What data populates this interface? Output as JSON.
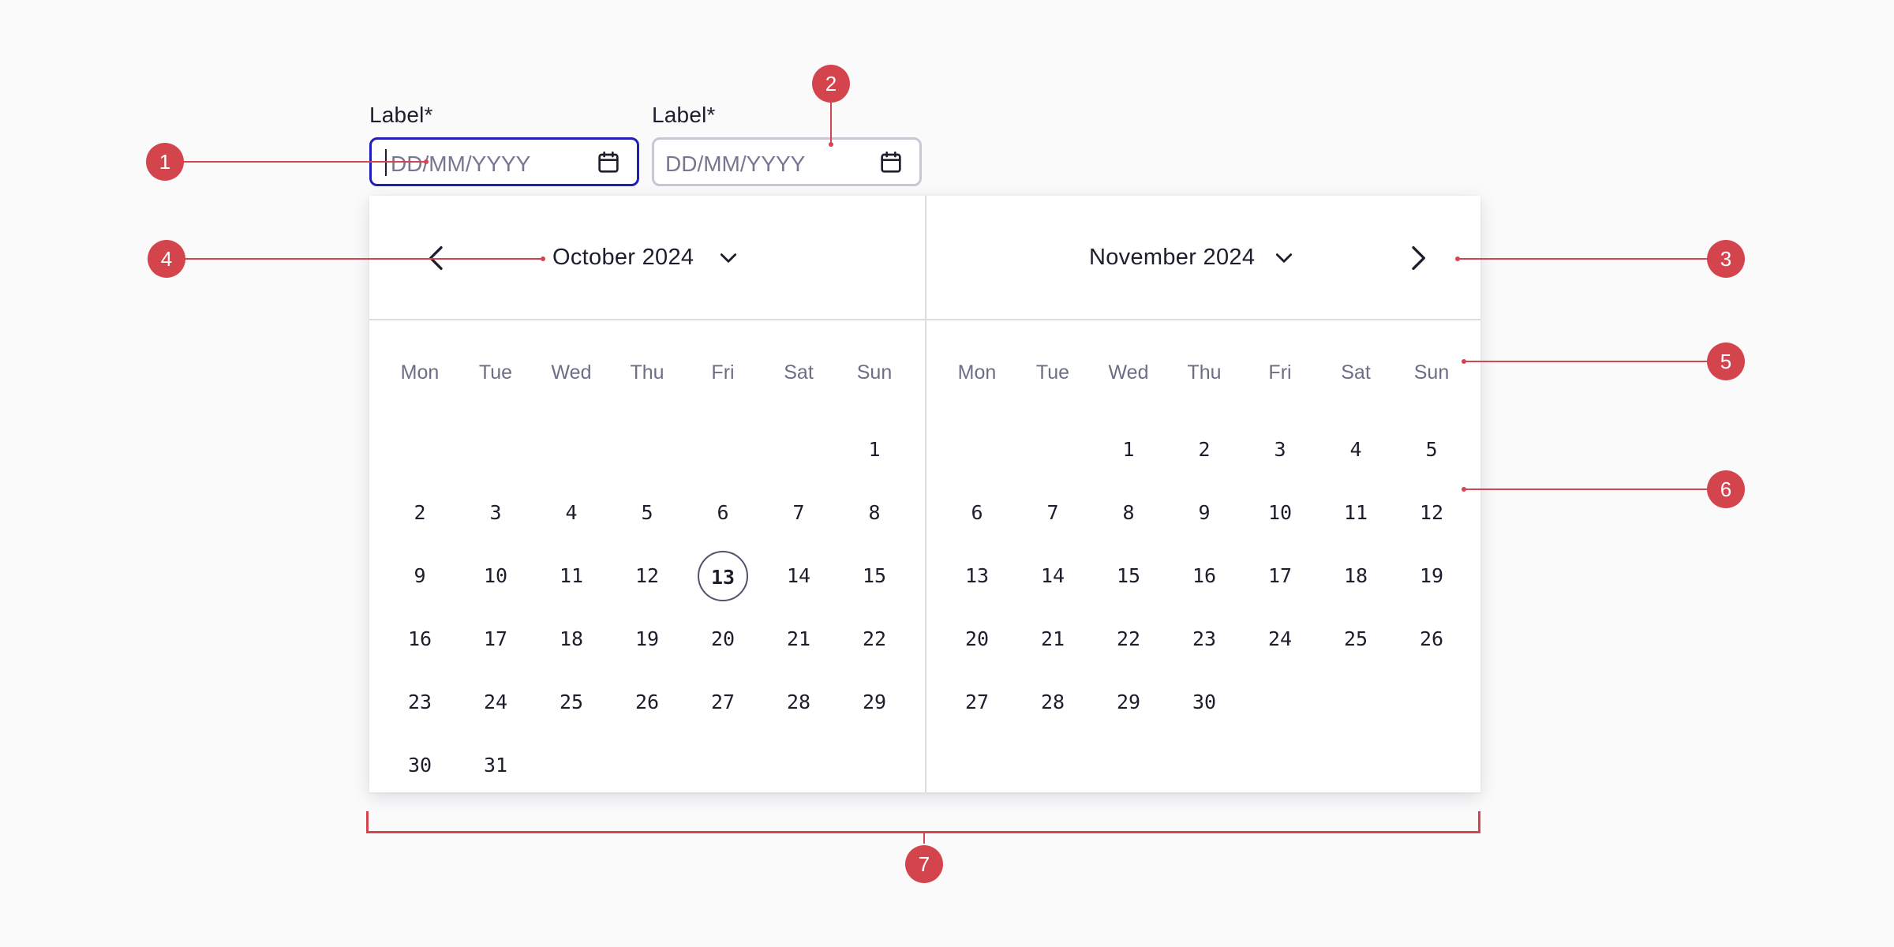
{
  "fields": [
    {
      "label": "Label",
      "required_mark": "*",
      "placeholder": "DD/MM/YYYY",
      "state": "focused",
      "icon": "calendar-icon"
    },
    {
      "label": "Label",
      "required_mark": "*",
      "placeholder": "DD/MM/YYYY",
      "state": "default",
      "icon": "calendar-icon"
    }
  ],
  "calendar": {
    "left_month": {
      "title": "October 2024"
    },
    "right_month": {
      "title": "November 2024"
    },
    "weekdays": [
      "Mon",
      "Tue",
      "Wed",
      "Thu",
      "Fri",
      "Sat",
      "Sun"
    ],
    "left_days": [
      [
        "",
        "",
        "",
        "",
        "",
        "",
        "1"
      ],
      [
        "2",
        "3",
        "4",
        "5",
        "6",
        "7",
        "8"
      ],
      [
        "9",
        "10",
        "11",
        "12",
        "13",
        "14",
        "15"
      ],
      [
        "16",
        "17",
        "18",
        "19",
        "20",
        "21",
        "22"
      ],
      [
        "23",
        "24",
        "25",
        "26",
        "27",
        "28",
        "29"
      ],
      [
        "30",
        "31",
        "",
        "",
        "",
        "",
        ""
      ]
    ],
    "right_days": [
      [
        "",
        "",
        "1",
        "2",
        "3",
        "4",
        "5"
      ],
      [
        "6",
        "7",
        "8",
        "9",
        "10",
        "11",
        "12"
      ],
      [
        "13",
        "14",
        "15",
        "16",
        "17",
        "18",
        "19"
      ],
      [
        "20",
        "21",
        "22",
        "23",
        "24",
        "25",
        "26"
      ],
      [
        "27",
        "28",
        "29",
        "30",
        "",
        "",
        ""
      ]
    ],
    "today": "13"
  },
  "annotations": [
    "1",
    "2",
    "3",
    "4",
    "5",
    "6",
    "7"
  ],
  "colors": {
    "focus_border": "#1f1fb8",
    "annotation": "#d4444d",
    "today_ring": "#50536a"
  }
}
